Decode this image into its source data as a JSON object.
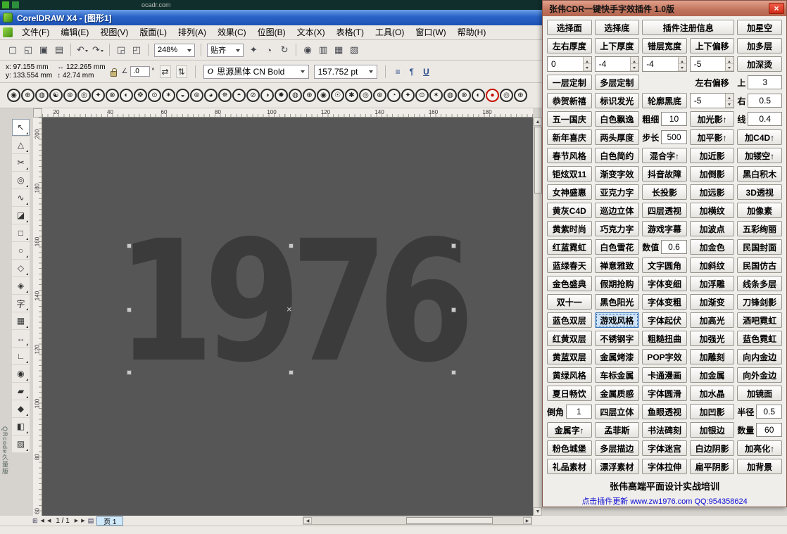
{
  "top_strip": {
    "text": "ocadr.com"
  },
  "window": {
    "title": "CorelDRAW X4 - [图形1]",
    "menus": [
      "文件(F)",
      "编辑(E)",
      "视图(V)",
      "版面(L)",
      "排列(A)",
      "效果(C)",
      "位图(B)",
      "文本(X)",
      "表格(T)",
      "工具(O)",
      "窗口(W)",
      "帮助(H)"
    ],
    "toolbar": {
      "items": [
        {
          "type": "icon",
          "name": "new-document-icon",
          "glyph": "▢"
        },
        {
          "type": "icon",
          "name": "open-icon",
          "glyph": "◱"
        },
        {
          "type": "icon",
          "name": "save-icon",
          "glyph": "▣"
        },
        {
          "type": "icon",
          "name": "print-icon",
          "glyph": "▤"
        },
        {
          "type": "sep"
        },
        {
          "type": "icon",
          "name": "undo-icon",
          "glyph": "↶",
          "caret": true
        },
        {
          "type": "icon",
          "name": "redo-icon",
          "glyph": "↷",
          "caret": true
        },
        {
          "type": "sep"
        },
        {
          "type": "icon",
          "name": "import-icon",
          "glyph": "◲"
        },
        {
          "type": "icon",
          "name": "export-icon",
          "glyph": "◰"
        },
        {
          "type": "sep"
        },
        {
          "type": "combo",
          "name": "zoom-level-combo",
          "value": "248%"
        },
        {
          "type": "sep"
        },
        {
          "type": "combo",
          "name": "snap-combo",
          "value": "贴齐"
        },
        {
          "type": "icon",
          "name": "welcome-icon",
          "glyph": "✦"
        },
        {
          "type": "icon",
          "name": "options-icon",
          "glyph": "◔"
        },
        {
          "type": "icon",
          "name": "refresh-icon",
          "glyph": "↻"
        },
        {
          "type": "sep"
        },
        {
          "type": "icon",
          "name": "view-eye-icon",
          "glyph": "◉"
        },
        {
          "type": "icon",
          "name": "barcode-icon",
          "glyph": "▥"
        },
        {
          "type": "icon",
          "name": "docker-icon",
          "glyph": "▦"
        },
        {
          "type": "icon",
          "name": "layout-icon",
          "glyph": "▧"
        }
      ]
    },
    "property_bar": {
      "x_label": "x:",
      "x_value": "97.155 mm",
      "y_label": "y:",
      "y_value": "133.554 mm",
      "width_value": "122.265 mm",
      "height_value": "42.74 mm",
      "rotation_value": ".0",
      "rotation_unit": "°",
      "font_name": "思源黑体 CN Bold",
      "font_size": "157.752 pt",
      "icons": {
        "width": "↔",
        "height": "↕",
        "rotation": "∠",
        "mirror_h": "⇄",
        "mirror_v": "⇅",
        "font_marker": "O",
        "align": "≡",
        "paragraph": "¶",
        "underline": "U"
      }
    },
    "symbols": {
      "glyphs": [
        "◉",
        "⊕",
        "◍",
        "☯",
        "⊛",
        "◎",
        "✦",
        "⊗",
        "◐",
        "☸",
        "⊙",
        "✶",
        "◒",
        "⊜",
        "◕",
        "✵",
        "◓",
        "⊘",
        "◑",
        "✹",
        "◍",
        "⊕",
        "◉",
        "☉",
        "✱",
        "◎",
        "⊛",
        "◔",
        "✦",
        "⊙",
        "✶",
        "◍",
        "⊗",
        "◐",
        "●",
        "◎",
        "⊕"
      ],
      "red_index": 34
    },
    "rulers": {
      "horizontal": [
        "20",
        "40",
        "60",
        "80",
        "100",
        "120",
        "140",
        "160",
        "180"
      ],
      "vertical": [
        "200",
        "180",
        "160",
        "140",
        "120",
        "100",
        "80",
        "60"
      ]
    },
    "toolbox": [
      {
        "name": "pick-tool",
        "glyph": "↖",
        "selected": true
      },
      {
        "name": "shape-tool",
        "glyph": "△"
      },
      {
        "name": "crop-tool",
        "glyph": "✂"
      },
      {
        "name": "zoom-tool",
        "glyph": "◎"
      },
      {
        "name": "freehand-tool",
        "glyph": "∿"
      },
      {
        "name": "smart-fill-tool",
        "glyph": "◪"
      },
      {
        "name": "rectangle-tool",
        "glyph": "□"
      },
      {
        "name": "ellipse-tool",
        "glyph": "○"
      },
      {
        "name": "polygon-tool",
        "glyph": "◇"
      },
      {
        "name": "basic-shapes-tool",
        "glyph": "◈"
      },
      {
        "name": "text-tool",
        "glyph": "字"
      },
      {
        "name": "table-tool",
        "glyph": "▦"
      },
      {
        "name": "dimension-tool",
        "glyph": "↔"
      },
      {
        "name": "connector-tool",
        "glyph": "∟"
      },
      {
        "name": "blend-tool",
        "glyph": "◉"
      },
      {
        "name": "eyedropper-tool",
        "glyph": "▰"
      },
      {
        "name": "outline-pen-tool",
        "glyph": "◆"
      },
      {
        "name": "fill-tool",
        "glyph": "◧"
      },
      {
        "name": "interactive-fill-tool",
        "glyph": "▨"
      }
    ],
    "canvas": {
      "text": "1976",
      "center_glyph": "×"
    },
    "scroll_icons": {
      "up": "▲",
      "down": "▼",
      "left": "◀",
      "right": "▶"
    },
    "page_bar": {
      "page_info": "1 / 1",
      "tab_label": "页 1",
      "icons": {
        "add": "⊞",
        "first": "◀",
        "prev": "◀",
        "next": "▶",
        "last": "▶",
        "page": "▤"
      }
    },
    "qr_watermark": "QRcode久量版"
  },
  "plugin": {
    "title": "张伟CDR一键快手字效插件  1.0版",
    "close_glyph": "×",
    "rows": [
      [
        {
          "t": "b",
          "l": "选择面"
        },
        {
          "t": "b",
          "l": "选择底"
        },
        {
          "t": "b",
          "l": "插件注册信息",
          "w": 2
        },
        {
          "t": "b",
          "l": "加星空"
        }
      ],
      [
        {
          "t": "b",
          "l": "左右厚度"
        },
        {
          "t": "b",
          "l": "上下厚度"
        },
        {
          "t": "b",
          "l": "错层宽度"
        },
        {
          "t": "b",
          "l": "上下偏移"
        },
        {
          "t": "b",
          "l": "加多层"
        }
      ],
      [
        {
          "t": "s",
          "v": "0"
        },
        {
          "t": "s",
          "v": "-4"
        },
        {
          "t": "s",
          "v": "-4"
        },
        {
          "t": "s",
          "v": "-5"
        },
        {
          "t": "b",
          "l": "加深烫"
        }
      ],
      [
        {
          "t": "b",
          "l": "一层定制"
        },
        {
          "t": "b",
          "l": "多层定制"
        },
        {
          "t": "e"
        },
        {
          "t": "l",
          "l": "左右偏移"
        },
        {
          "t": "v",
          "l": "上",
          "v": "3"
        }
      ],
      [
        {
          "t": "b",
          "l": "恭贺新禧"
        },
        {
          "t": "b",
          "l": "标识发光"
        },
        {
          "t": "b",
          "l": "轮廓黑底"
        },
        {
          "t": "s",
          "v": "-5"
        },
        {
          "t": "v",
          "l": "右",
          "v": "0.5"
        }
      ],
      [
        {
          "t": "b",
          "l": "五一国庆"
        },
        {
          "t": "b",
          "l": "白色飘逸"
        },
        {
          "t": "v",
          "l": "粗细",
          "v": "10"
        },
        {
          "t": "b",
          "l": "加光影↑"
        },
        {
          "t": "v",
          "l": "线",
          "v": "0.4"
        }
      ],
      [
        {
          "t": "b",
          "l": "新年喜庆"
        },
        {
          "t": "b",
          "l": "两头厚度"
        },
        {
          "t": "v",
          "l": "步长",
          "v": "500"
        },
        {
          "t": "b",
          "l": "加平影↑"
        },
        {
          "t": "b",
          "l": "加C4D↑"
        }
      ],
      [
        {
          "t": "b",
          "l": "春节风格"
        },
        {
          "t": "b",
          "l": "白色简约"
        },
        {
          "t": "b",
          "l": "混合字↑"
        },
        {
          "t": "b",
          "l": "加近影"
        },
        {
          "t": "b",
          "l": "加镂空↑"
        }
      ],
      [
        {
          "t": "b",
          "l": "钜炫双11"
        },
        {
          "t": "b",
          "l": "渐变字效"
        },
        {
          "t": "b",
          "l": "抖音故障"
        },
        {
          "t": "b",
          "l": "加倒影"
        },
        {
          "t": "b",
          "l": "黑白积木"
        }
      ],
      [
        {
          "t": "b",
          "l": "女神盛惠"
        },
        {
          "t": "b",
          "l": "亚克力字"
        },
        {
          "t": "b",
          "l": "长投影"
        },
        {
          "t": "b",
          "l": "加远影"
        },
        {
          "t": "b",
          "l": "3D透视"
        }
      ],
      [
        {
          "t": "b",
          "l": "黄灰C4D"
        },
        {
          "t": "b",
          "l": "巡边立体"
        },
        {
          "t": "b",
          "l": "四层透视"
        },
        {
          "t": "b",
          "l": "加横纹"
        },
        {
          "t": "b",
          "l": "加像素"
        }
      ],
      [
        {
          "t": "b",
          "l": "黄紫时尚"
        },
        {
          "t": "b",
          "l": "巧克力字"
        },
        {
          "t": "b",
          "l": "游戏字幕"
        },
        {
          "t": "b",
          "l": "加波点"
        },
        {
          "t": "b",
          "l": "五彩绚丽"
        }
      ],
      [
        {
          "t": "b",
          "l": "红蓝霓虹"
        },
        {
          "t": "b",
          "l": "白色雪花"
        },
        {
          "t": "v",
          "l": "数值",
          "v": "0.6"
        },
        {
          "t": "b",
          "l": "加金色"
        },
        {
          "t": "b",
          "l": "民国封面"
        }
      ],
      [
        {
          "t": "b",
          "l": "蓝绿春天"
        },
        {
          "t": "b",
          "l": "禅意雅致"
        },
        {
          "t": "b",
          "l": "文字圆角"
        },
        {
          "t": "b",
          "l": "加斜纹"
        },
        {
          "t": "b",
          "l": "民国仿古"
        }
      ],
      [
        {
          "t": "b",
          "l": "金色盛典"
        },
        {
          "t": "b",
          "l": "假期抢购"
        },
        {
          "t": "b",
          "l": "字体变细"
        },
        {
          "t": "b",
          "l": "加浮雕"
        },
        {
          "t": "b",
          "l": "线条多层"
        }
      ],
      [
        {
          "t": "b",
          "l": "双十一"
        },
        {
          "t": "b",
          "l": "黑色阳光"
        },
        {
          "t": "b",
          "l": "字体变粗"
        },
        {
          "t": "b",
          "l": "加渐变"
        },
        {
          "t": "b",
          "l": "刀锋剑影"
        }
      ],
      [
        {
          "t": "b",
          "l": "蓝色双层"
        },
        {
          "t": "b",
          "l": "游戏风格",
          "sel": true
        },
        {
          "t": "b",
          "l": "字体起伏"
        },
        {
          "t": "b",
          "l": "加高光"
        },
        {
          "t": "b",
          "l": "酒吧霓虹"
        }
      ],
      [
        {
          "t": "b",
          "l": "红黄双层"
        },
        {
          "t": "b",
          "l": "不锈钢字"
        },
        {
          "t": "b",
          "l": "粗糙扭曲"
        },
        {
          "t": "b",
          "l": "加强光"
        },
        {
          "t": "b",
          "l": "蓝色霓虹"
        }
      ],
      [
        {
          "t": "b",
          "l": "黄蓝双层"
        },
        {
          "t": "b",
          "l": "金属烤漆"
        },
        {
          "t": "b",
          "l": "POP字效"
        },
        {
          "t": "b",
          "l": "加雕刻"
        },
        {
          "t": "b",
          "l": "向内金边"
        }
      ],
      [
        {
          "t": "b",
          "l": "黄绿风格"
        },
        {
          "t": "b",
          "l": "车标金属"
        },
        {
          "t": "b",
          "l": "卡通漫画"
        },
        {
          "t": "b",
          "l": "加金属"
        },
        {
          "t": "b",
          "l": "向外金边"
        }
      ],
      [
        {
          "t": "b",
          "l": "夏日畅饮"
        },
        {
          "t": "b",
          "l": "金属质感"
        },
        {
          "t": "b",
          "l": "字体圆滑"
        },
        {
          "t": "b",
          "l": "加水晶"
        },
        {
          "t": "b",
          "l": "加镜面"
        }
      ],
      [
        {
          "t": "v",
          "l": "倒角",
          "v": "1"
        },
        {
          "t": "b",
          "l": "四层立体"
        },
        {
          "t": "b",
          "l": "鱼眼透视"
        },
        {
          "t": "b",
          "l": "加凹影"
        },
        {
          "t": "v",
          "l": "半径",
          "v": "0.5"
        }
      ],
      [
        {
          "t": "b",
          "l": "金属字↑"
        },
        {
          "t": "b",
          "l": "孟菲斯"
        },
        {
          "t": "b",
          "l": "书法碑刻"
        },
        {
          "t": "b",
          "l": "加银边"
        },
        {
          "t": "v",
          "l": "数量",
          "v": "60"
        }
      ],
      [
        {
          "t": "b",
          "l": "粉色城堡"
        },
        {
          "t": "b",
          "l": "多层描边"
        },
        {
          "t": "b",
          "l": "字体迷宫"
        },
        {
          "t": "b",
          "l": "白边阴影"
        },
        {
          "t": "b",
          "l": "加亮化↑"
        }
      ],
      [
        {
          "t": "b",
          "l": "礼品素材"
        },
        {
          "t": "b",
          "l": "漂浮素材"
        },
        {
          "t": "b",
          "l": "字体拉伸"
        },
        {
          "t": "b",
          "l": "扁平阴影"
        },
        {
          "t": "b",
          "l": "加背景"
        }
      ]
    ],
    "footer": "张伟高端平面设计实战培训",
    "links": "点击插件更新 www.zw1976.com    QQ:954358624"
  }
}
